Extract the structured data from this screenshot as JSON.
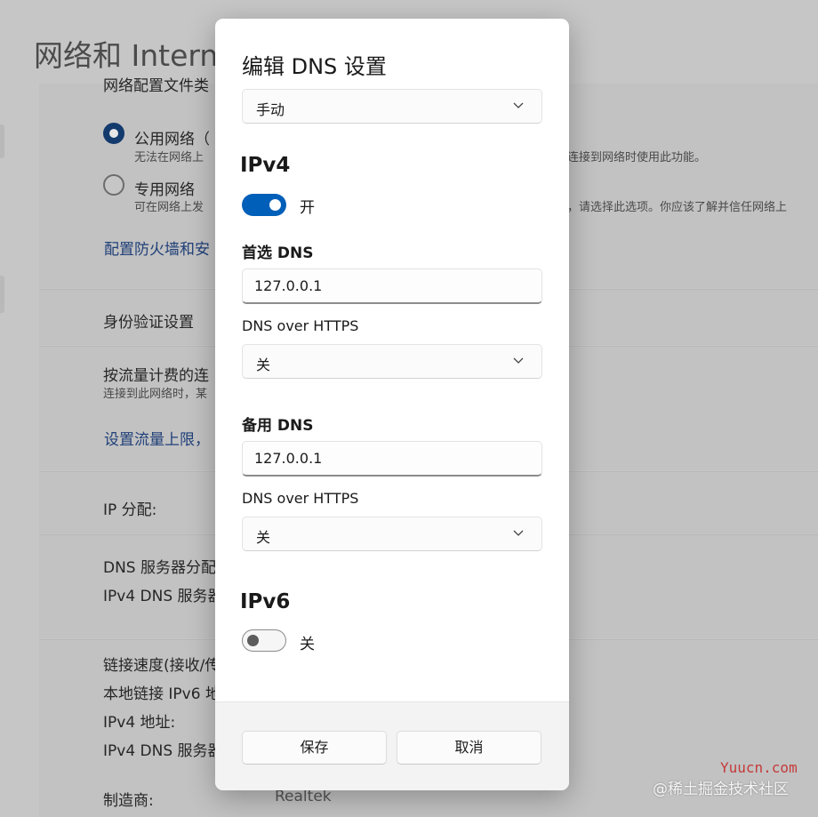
{
  "background": {
    "page_title": "网络和 Intern",
    "partial_heading": "网络配置文件类",
    "public_network": {
      "label": "公用网络（",
      "desc": "无法在网络上",
      "desc_right": "连接到网络时使用此功能。"
    },
    "private_network": {
      "label": "专用网络",
      "desc": "可在网络上发",
      "desc_right": "，请选择此选项。你应该了解并信任网络上"
    },
    "firewall_link": "配置防火墙和安",
    "auth_settings": "身份验证设置",
    "metered": {
      "label": "按流量计费的连",
      "desc": "连接到此网络时，某"
    },
    "data_limit_link": "设置流量上限，",
    "ip_assignment": "IP 分配:",
    "dns_assignment": "DNS 服务器分配",
    "ipv4_dns_server_1": "IPv4 DNS 服务器",
    "link_speed": "链接速度(接收/传",
    "local_ipv6": "本地链接 IPv6 地",
    "ipv4_address": "IPv4 地址:",
    "ipv4_dns_server_2": "IPv4 DNS 服务器",
    "manufacturer_label": "制造商:",
    "manufacturer_value": "Realtek"
  },
  "dialog": {
    "title": "编辑 DNS 设置",
    "mode_select": "手动",
    "ipv4": {
      "heading": "IPv4",
      "toggle_label": "开",
      "toggle_on": true,
      "preferred_dns_label": "首选 DNS",
      "preferred_dns_value": "127.0.0.1",
      "preferred_doh_label": "DNS over HTTPS",
      "preferred_doh_value": "关",
      "alternate_dns_label": "备用 DNS",
      "alternate_dns_value": "127.0.0.1",
      "alternate_doh_label": "DNS over HTTPS",
      "alternate_doh_value": "关"
    },
    "ipv6": {
      "heading": "IPv6",
      "toggle_label": "关",
      "toggle_on": false
    },
    "save_button": "保存",
    "cancel_button": "取消"
  },
  "watermark": {
    "site": "Yuucn.com",
    "community": "@稀土掘金技术社区"
  },
  "colors": {
    "accent": "#005fb8",
    "link": "#1f3f78",
    "watermark_red": "#c43b3b"
  }
}
